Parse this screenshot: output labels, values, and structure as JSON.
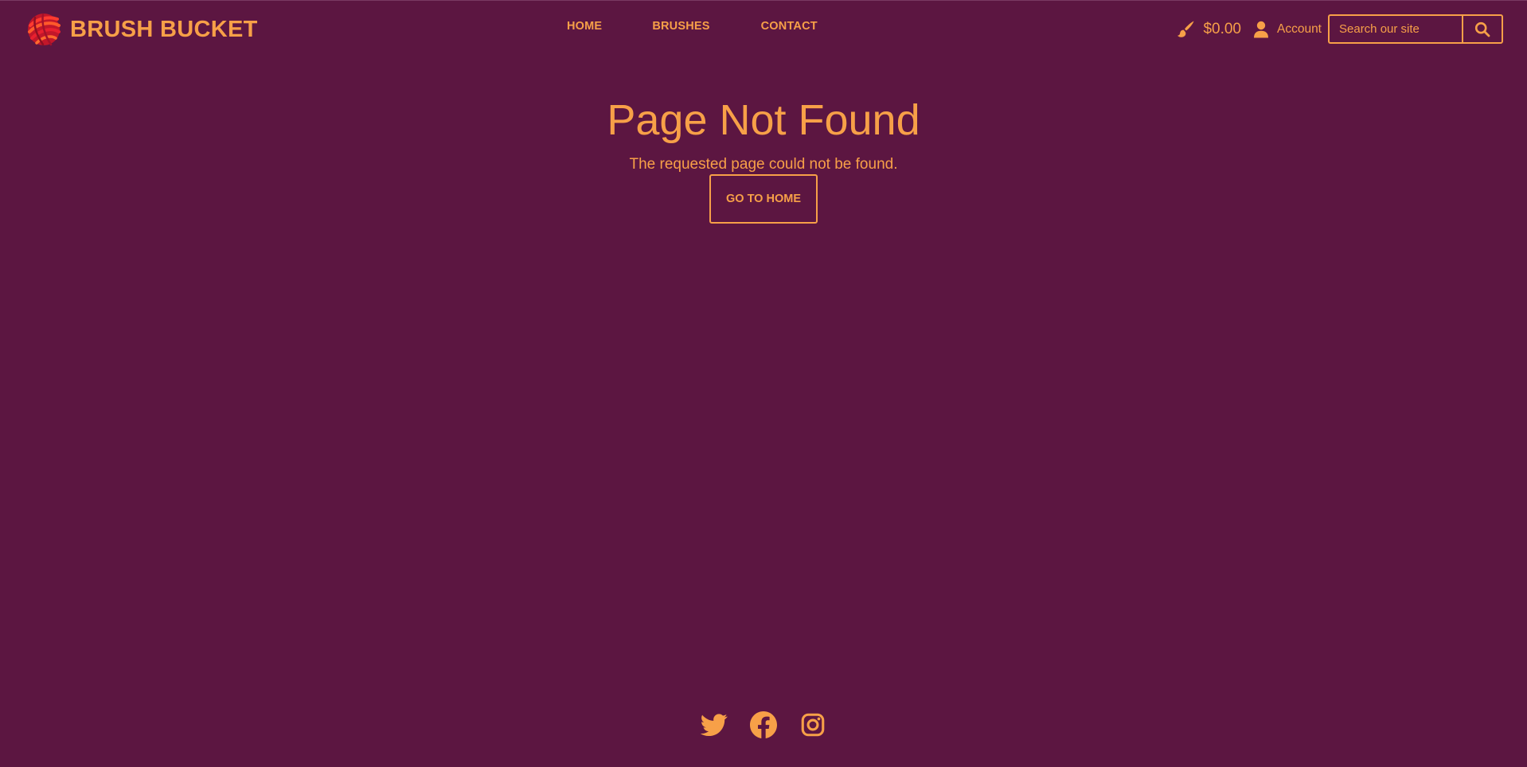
{
  "colors": {
    "background": "#5c1641",
    "accent": "#f7a048",
    "logo_red": "#e3262f"
  },
  "header": {
    "logo_text": "BRUSH BUCKET",
    "logo_icon": "brush-bucket-logo",
    "nav": [
      {
        "label": "HOME"
      },
      {
        "label": "BRUSHES"
      },
      {
        "label": "CONTACT"
      }
    ],
    "cart": {
      "icon": "paintbrush-icon",
      "total": "$0.00"
    },
    "account": {
      "icon": "user-icon",
      "label": "Account"
    },
    "search": {
      "placeholder": "Search our site",
      "value": "",
      "icon": "search-icon"
    }
  },
  "main": {
    "title": "Page Not Found",
    "message": "The requested page could not be found.",
    "button_label": "GO TO HOME"
  },
  "footer": {
    "social": [
      {
        "icon": "twitter-icon"
      },
      {
        "icon": "facebook-icon"
      },
      {
        "icon": "instagram-icon"
      }
    ]
  }
}
